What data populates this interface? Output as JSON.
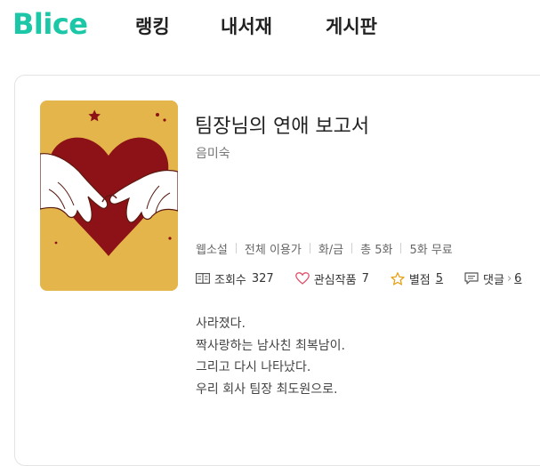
{
  "brand": {
    "logo": "Blice",
    "accent_color": "#1cc7a8"
  },
  "nav": {
    "items": [
      {
        "label": "랭킹"
      },
      {
        "label": "내서재"
      },
      {
        "label": "게시판"
      }
    ]
  },
  "book": {
    "title": "팀장님의 연애 보고서",
    "author": "음미숙",
    "cover_colors": {
      "background": "#e4b54a",
      "heart": "#8c1218"
    },
    "meta": [
      "웹소설",
      "전체 이용가",
      "화/금",
      "총 5화",
      "5화 무료"
    ],
    "stats": {
      "views_label": "조회수",
      "views_value": "327",
      "favorites_label": "관심작품",
      "favorites_value": "7",
      "rating_label": "별점",
      "rating_value": "5",
      "comments_label": "댓글",
      "comments_value": "6"
    },
    "synopsis": [
      "사라졌다.",
      "짝사랑하는 남사친 최복남이.",
      "그리고 다시 나타났다.",
      "우리 회사 팀장 최도원으로."
    ]
  }
}
